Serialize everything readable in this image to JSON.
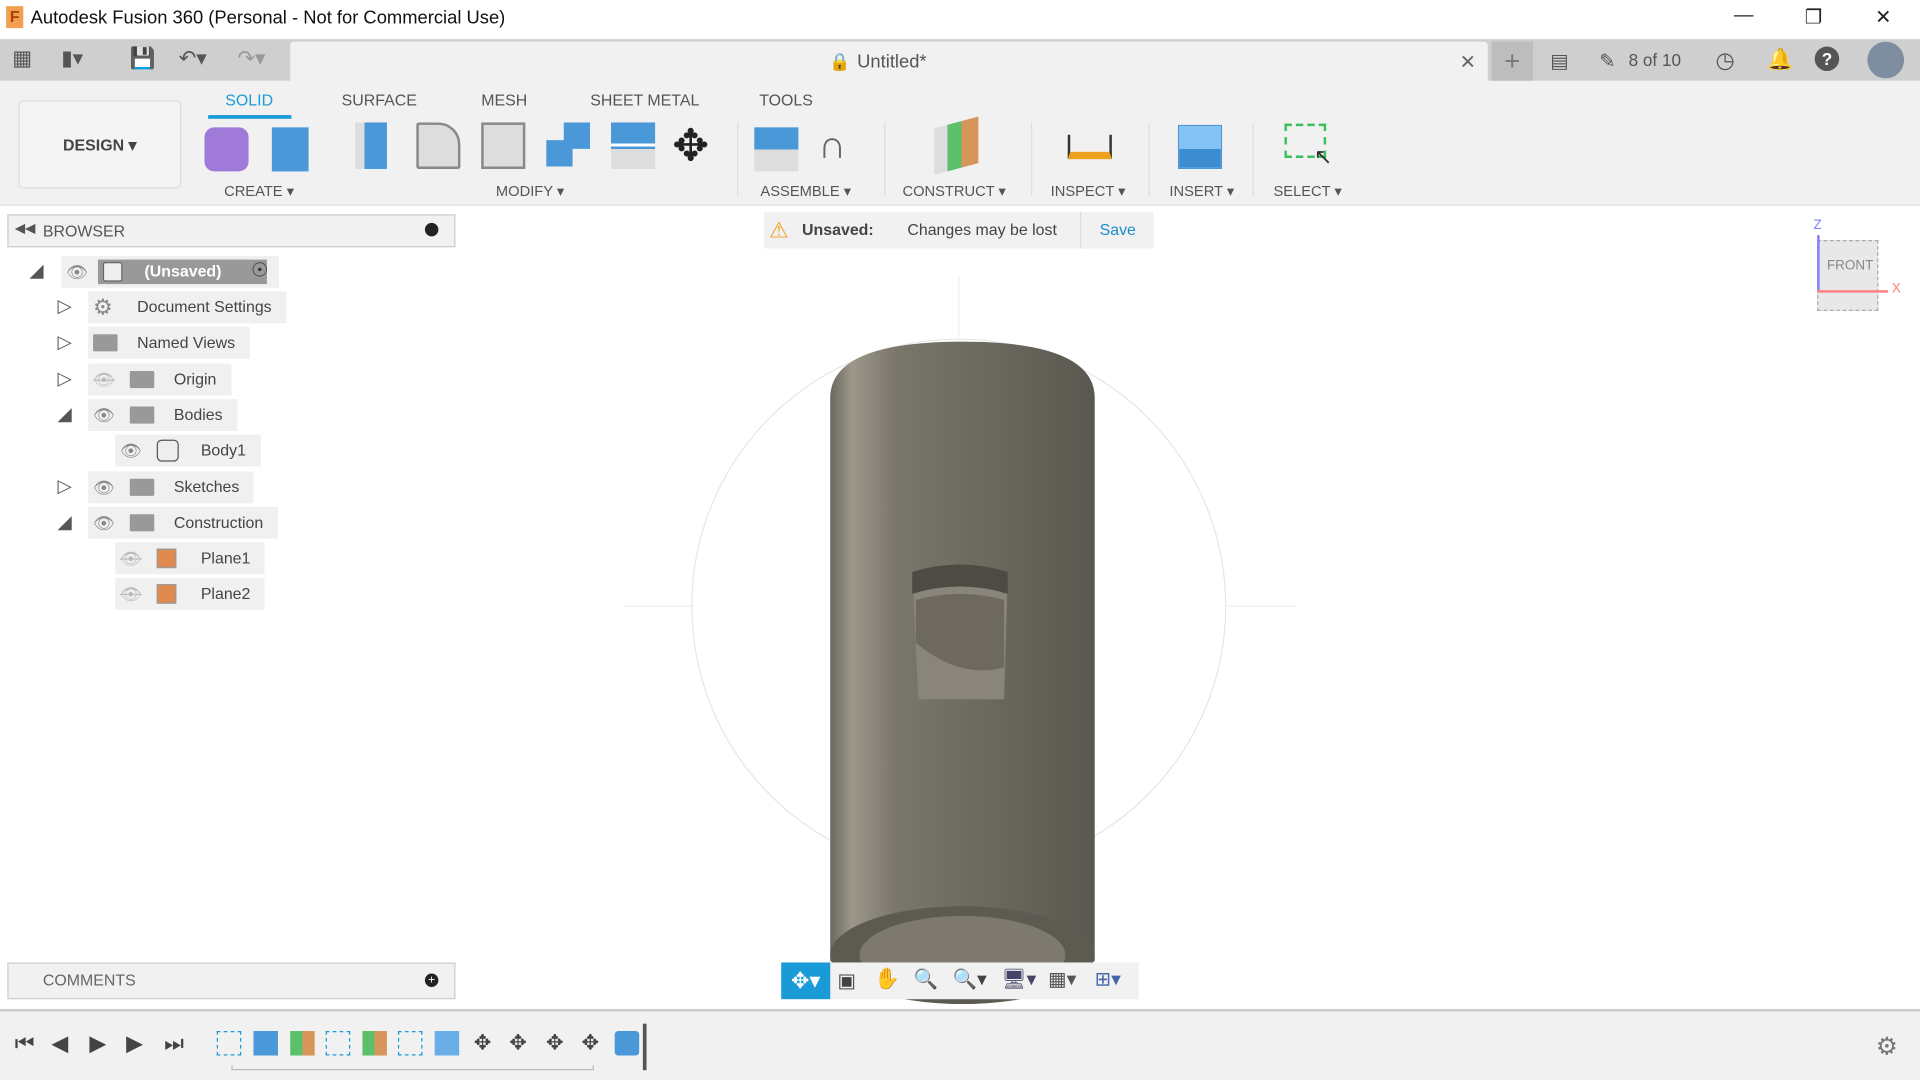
{
  "window": {
    "title": "Autodesk Fusion 360 (Personal - Not for Commercial Use)",
    "app_icon": "F",
    "controls": [
      "minimize",
      "restore",
      "close"
    ]
  },
  "quickbar": {
    "icons": [
      "grid-icon",
      "file-icon",
      "save-icon",
      "undo-icon",
      "redo-icon"
    ]
  },
  "document": {
    "title": "Untitled*",
    "lock_icon": "lock-icon"
  },
  "header_right": {
    "jobs_label": "8 of 10",
    "icons": [
      "new-tab-icon",
      "comment-icon",
      "job-status-icon",
      "clock-icon",
      "bell-icon",
      "help-icon",
      "avatar"
    ]
  },
  "ribbon": {
    "workspace": "DESIGN",
    "tabs": [
      {
        "label": "SOLID",
        "active": true
      },
      {
        "label": "SURFACE"
      },
      {
        "label": "MESH"
      },
      {
        "label": "SHEET METAL"
      },
      {
        "label": "TOOLS"
      }
    ],
    "groups": [
      {
        "label": "CREATE"
      },
      {
        "label": "MODIFY"
      },
      {
        "label": "ASSEMBLE"
      },
      {
        "label": "CONSTRUCT"
      },
      {
        "label": "INSPECT"
      },
      {
        "label": "INSERT"
      },
      {
        "label": "SELECT"
      }
    ]
  },
  "browser": {
    "title": "BROWSER",
    "root": "(Unsaved)",
    "items": [
      {
        "label": "Document Settings",
        "expand": "collapsed",
        "icon": "gear-icon"
      },
      {
        "label": "Named Views",
        "expand": "collapsed",
        "icon": "folder-icon"
      },
      {
        "label": "Origin",
        "expand": "collapsed",
        "visible": false,
        "icon": "folder-icon"
      },
      {
        "label": "Bodies",
        "expand": "expanded",
        "visible": true,
        "icon": "folder-icon"
      },
      {
        "label": "Body1",
        "visible": true,
        "icon": "body-icon"
      },
      {
        "label": "Sketches",
        "expand": "collapsed",
        "visible": true,
        "icon": "folder-icon"
      },
      {
        "label": "Construction",
        "expand": "expanded",
        "visible": true,
        "icon": "folder-icon"
      },
      {
        "label": "Plane1",
        "visible": false,
        "icon": "plane-icon"
      },
      {
        "label": "Plane2",
        "visible": false,
        "icon": "plane-icon"
      }
    ]
  },
  "banner": {
    "status": "Unsaved:",
    "message": "Changes may be lost",
    "action": "Save"
  },
  "viewcube": {
    "face": "FRONT",
    "axes": [
      "Z",
      "X"
    ]
  },
  "comments": {
    "title": "COMMENTS"
  },
  "colors": {
    "accent": "#1a9bd7",
    "body": "#7a766b",
    "warning": "#f0a020"
  }
}
